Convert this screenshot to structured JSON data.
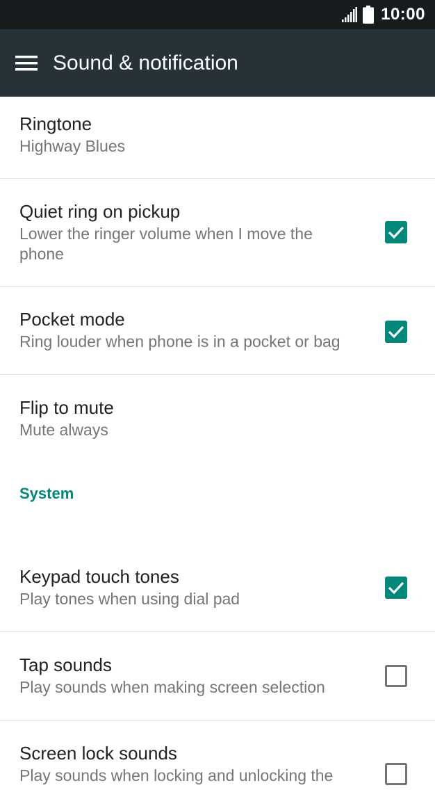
{
  "status_bar": {
    "time": "10:00",
    "icons": [
      "signal-icon",
      "battery-icon"
    ]
  },
  "toolbar": {
    "menu_icon": "hamburger-menu-icon",
    "title": "Sound & notification",
    "background": "#263238"
  },
  "accent_color": "#00897b",
  "settings": [
    {
      "title": "Ringtone",
      "subtitle": "Highway Blues",
      "checkbox": null
    },
    {
      "title": "Quiet ring on pickup",
      "subtitle": "Lower the ringer volume when I move the phone",
      "checkbox": true
    },
    {
      "title": "Pocket mode",
      "subtitle": "Ring louder when phone is in a pocket or bag",
      "checkbox": true
    },
    {
      "title": "Flip to mute",
      "subtitle": "Mute always",
      "checkbox": null
    }
  ],
  "system_section": {
    "label": "System",
    "items": [
      {
        "title": "Keypad touch tones",
        "subtitle": "Play tones when using dial pad",
        "checkbox": true
      },
      {
        "title": "Tap sounds",
        "subtitle": "Play sounds when making screen selection",
        "checkbox": false
      },
      {
        "title": "Screen lock sounds",
        "subtitle": "Play sounds when locking and unlocking the",
        "checkbox": false
      }
    ]
  }
}
